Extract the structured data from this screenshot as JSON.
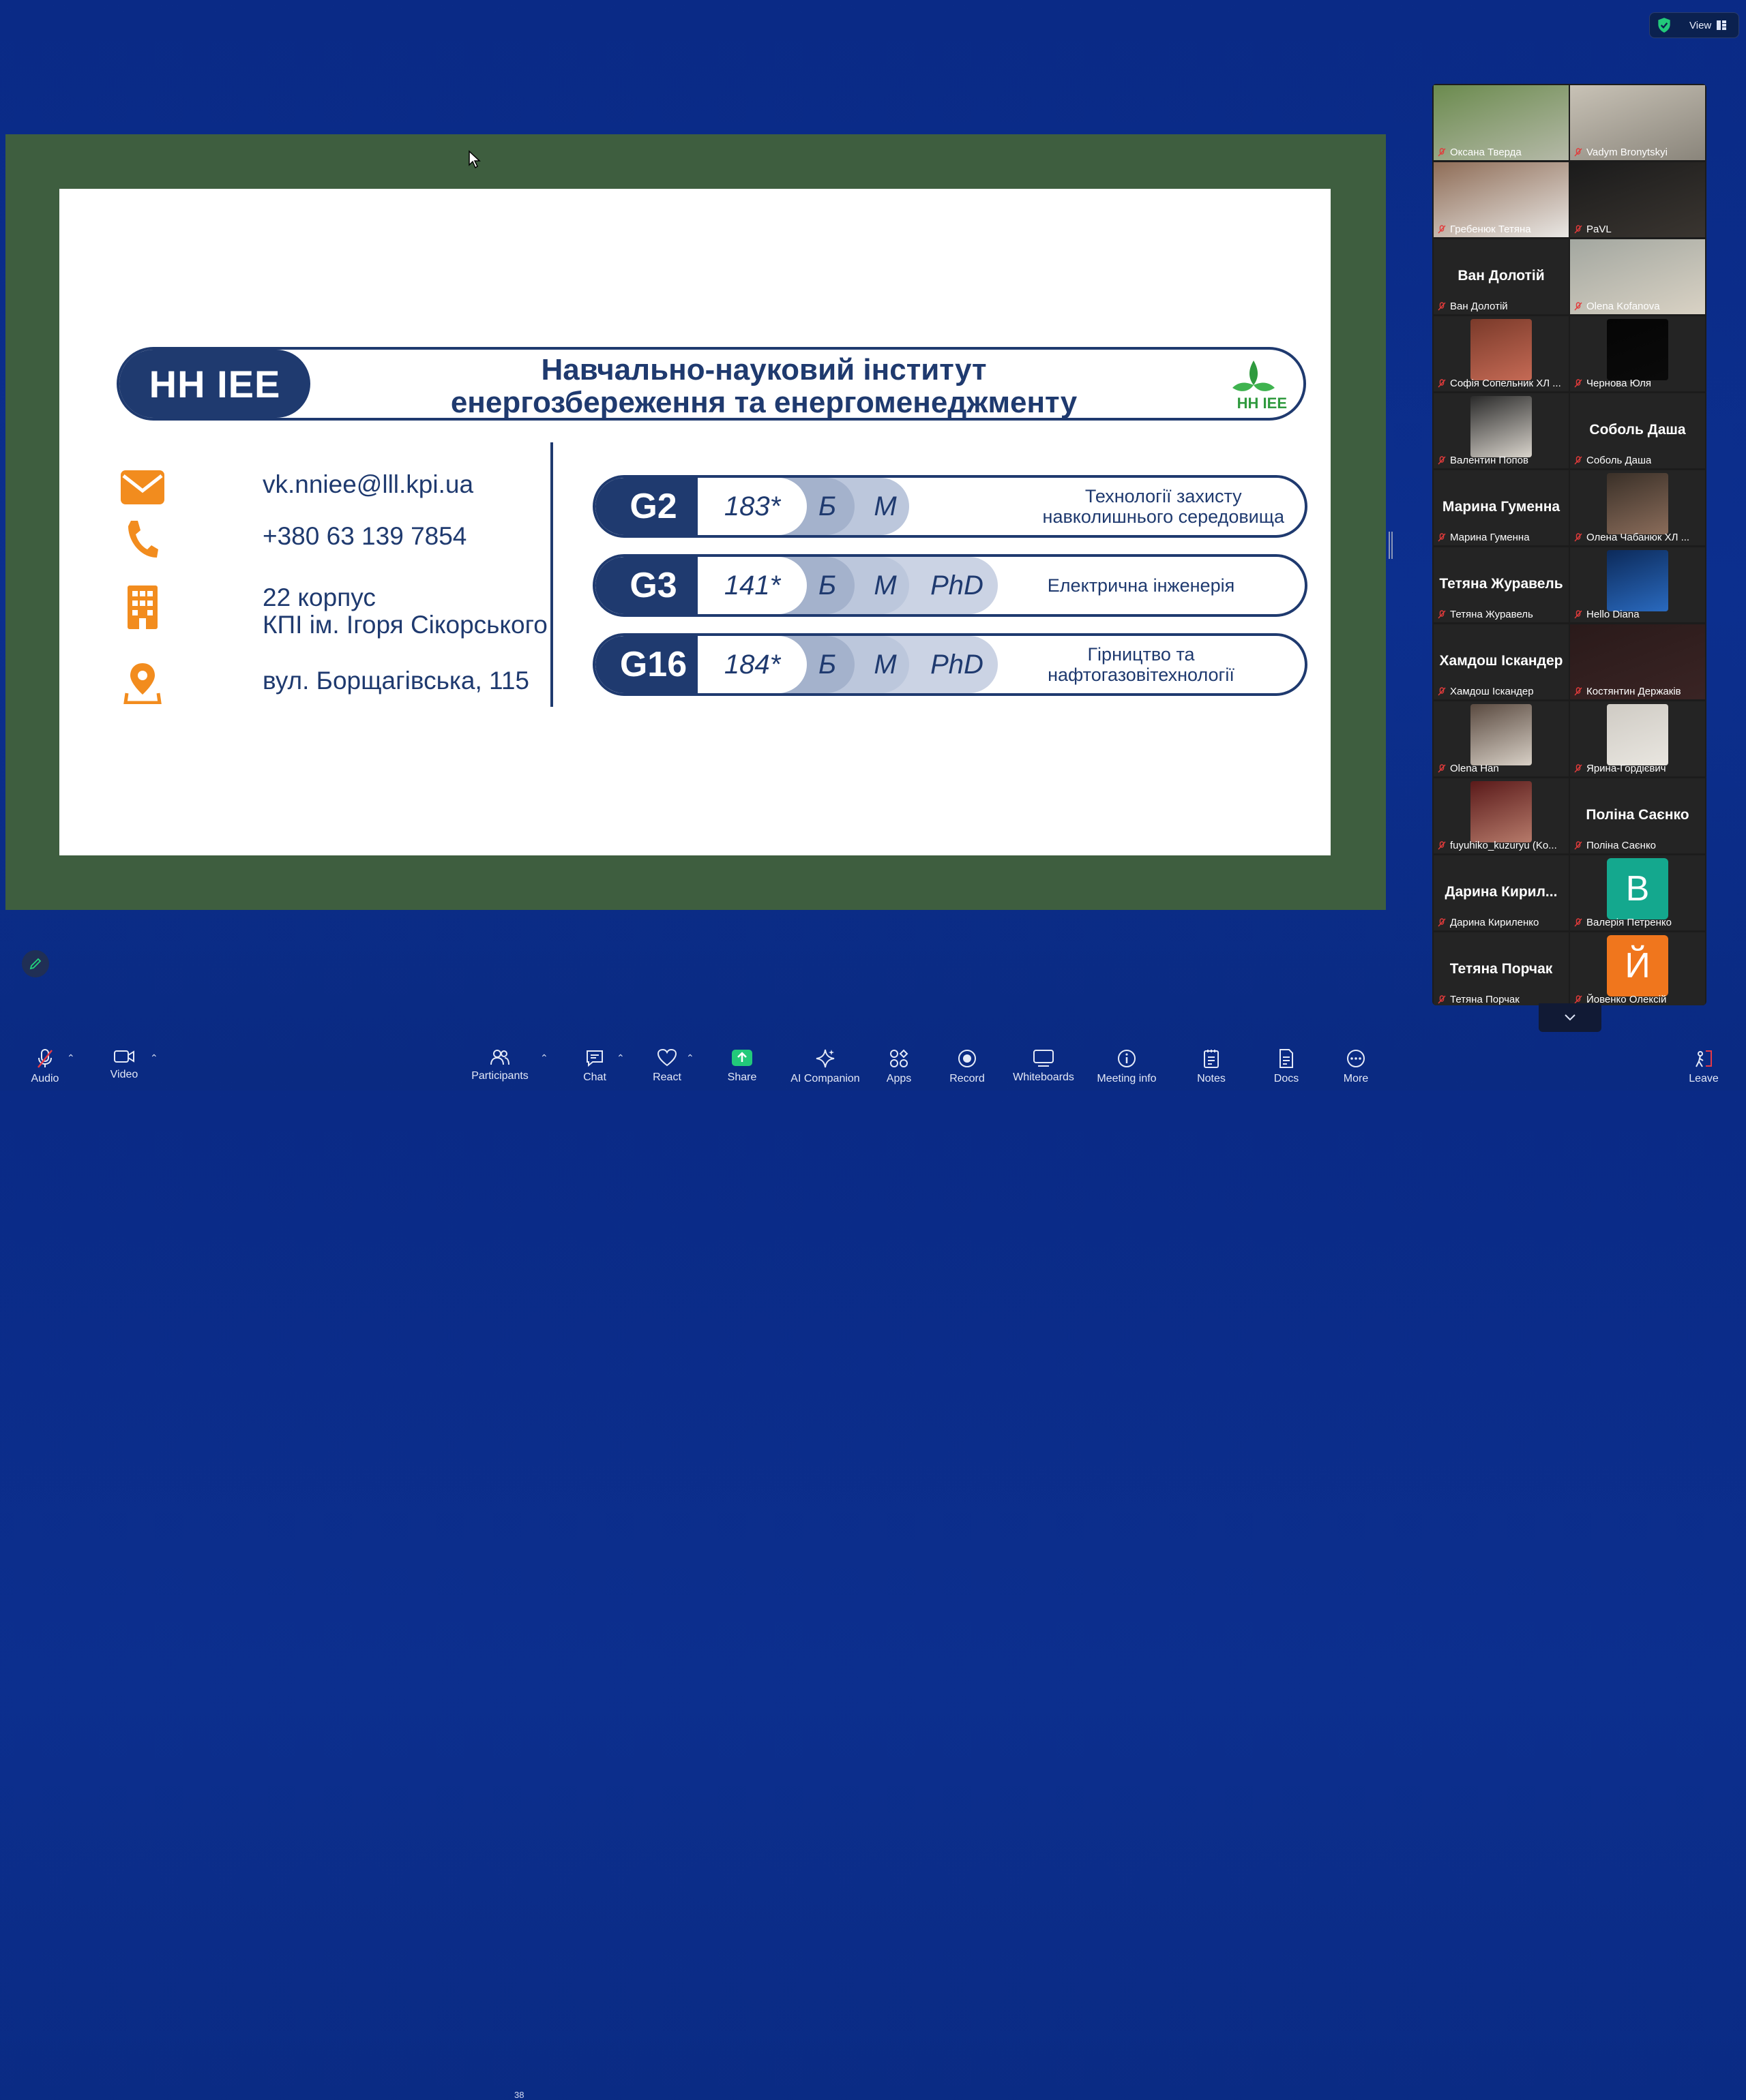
{
  "top_bar": {
    "view_label": "View"
  },
  "slide": {
    "banner_code": "НН IEE",
    "banner_title_line1": "Навчально-науковий інститут",
    "banner_title_line2": "енергозбереження та енергоменеджменту",
    "logo_text": "НН IEE",
    "contacts": {
      "email": "vk.nniee@lll.kpi.ua",
      "phone": "+380 63 139 7854",
      "building_line1": "22 корпус",
      "building_line2": "КПІ ім. Ігоря Сікорського",
      "address": "вул. Борщагівська, 115"
    },
    "programs": [
      {
        "code": "G2",
        "number": "183*",
        "b": "Б",
        "m": "М",
        "phd": "",
        "name_line1": "Технології захисту",
        "name_line2": "навколишнього середовища"
      },
      {
        "code": "G3",
        "number": "141*",
        "b": "Б",
        "m": "М",
        "phd": "PhD",
        "name_line1": "Електрична інженерія",
        "name_line2": ""
      },
      {
        "code": "G16",
        "number": "184*",
        "b": "Б",
        "m": "М",
        "phd": "PhD",
        "name_line1": "Гірництво та",
        "name_line2": "нафтогазовітехнології"
      }
    ]
  },
  "participants": [
    {
      "name": "Оксана Тверда",
      "video": true
    },
    {
      "name": "Vadym Bronytskyi",
      "video": true
    },
    {
      "name": "Гребенюк Тетяна",
      "video": true,
      "active": true
    },
    {
      "name": "PaVL",
      "video": true
    },
    {
      "name": "Ван Долотій",
      "video": false,
      "display": "Ван Долотій"
    },
    {
      "name": "Olena Kofanova",
      "video": true
    },
    {
      "name": "Софія Сопельник ХЛ ...",
      "video": true
    },
    {
      "name": "Чернова Юля",
      "video": true
    },
    {
      "name": "Валентин Попов",
      "video": true
    },
    {
      "name": "Соболь Даша",
      "video": false,
      "display": "Соболь Даша"
    },
    {
      "name": "Марина Гуменна",
      "video": false,
      "display": "Марина Гуменна"
    },
    {
      "name": "Олена Чабанюк ХЛ ...",
      "video": true
    },
    {
      "name": "Тетяна Журавель",
      "video": false,
      "display": "Тетяна Журавель"
    },
    {
      "name": "Hello Diana",
      "video": true
    },
    {
      "name": "Хамдош Іскандер",
      "video": false,
      "display": "Хамдош Іскандер"
    },
    {
      "name": "Костянтин Держаків",
      "video": true
    },
    {
      "name": "Olena Han",
      "video": true
    },
    {
      "name": "Ярина-Гордієвич",
      "video": true
    },
    {
      "name": "fuyuhiko_kuzuryu (Ko...",
      "video": true
    },
    {
      "name": "Поліна Саєнко",
      "video": false,
      "display": "Поліна Саєнко"
    },
    {
      "name": "Дарина Кириленко",
      "video": false,
      "display": "Дарина  Кирил..."
    },
    {
      "name": "Валерія Петренко",
      "video": false,
      "avatar_letter": "В",
      "avatar_color": "#14a88e"
    },
    {
      "name": "Тетяна Порчак",
      "video": false,
      "display": "Тетяна Порчак"
    },
    {
      "name": "Йовенко Олексій",
      "video": false,
      "avatar_letter": "Й",
      "avatar_color": "#f0761d"
    }
  ],
  "toolbar": {
    "audio": "Audio",
    "video": "Video",
    "participants": "Participants",
    "participants_count": "38",
    "chat": "Chat",
    "react": "React",
    "share": "Share",
    "ai_companion": "AI Companion",
    "apps": "Apps",
    "record": "Record",
    "whiteboards": "Whiteboards",
    "meeting_info": "Meeting info",
    "notes": "Notes",
    "docs": "Docs",
    "more": "More",
    "leave": "Leave"
  },
  "colors": {
    "brand_navy": "#1f3a6f",
    "share_border": "#3e5e3f",
    "accent_orange": "#f28c1e",
    "active_speaker": "#22d27d",
    "share_green": "#22c97a"
  }
}
